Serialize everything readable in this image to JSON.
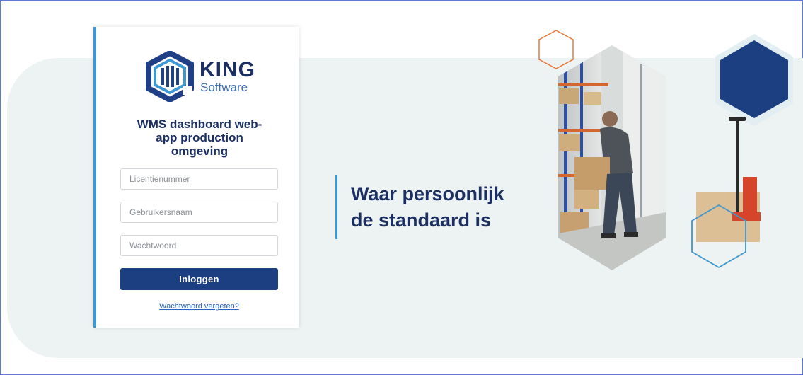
{
  "logo": {
    "title": "KING",
    "subtitle": "Software"
  },
  "login": {
    "title": "WMS dashboard web-app production omgeving",
    "license_placeholder": "Licentienummer",
    "username_placeholder": "Gebruikersnaam",
    "password_placeholder": "Wachtwoord",
    "submit_label": "Inloggen",
    "forgot_link": "Wachtwoord vergeten?"
  },
  "hero": {
    "tagline_line1": "Waar persoonlijk",
    "tagline_line2": "de standaard is",
    "image": "warehouse-worker-hexagon-photo"
  },
  "colors": {
    "navy": "#1c3f82",
    "accent_blue": "#3e97d1",
    "orange": "#e8773a",
    "background": "#edf2f2"
  }
}
